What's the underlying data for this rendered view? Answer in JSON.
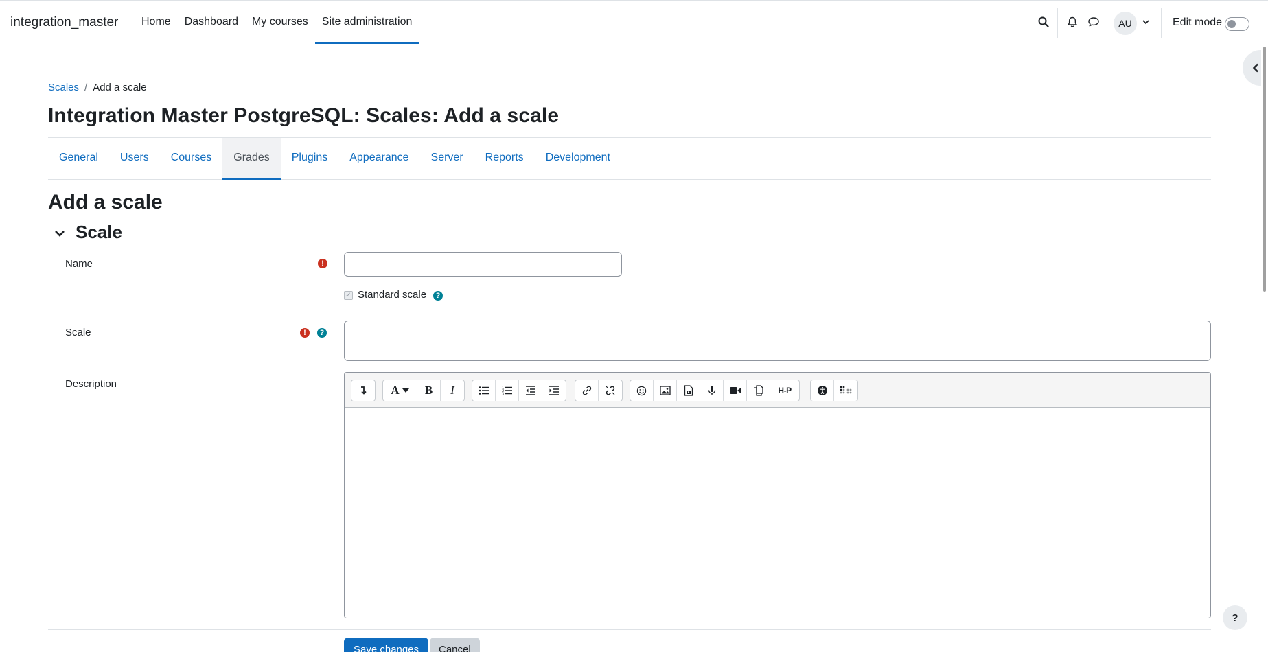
{
  "site": {
    "brand": "integration_master"
  },
  "primary_nav": [
    {
      "label": "Home",
      "active": false
    },
    {
      "label": "Dashboard",
      "active": false
    },
    {
      "label": "My courses",
      "active": false
    },
    {
      "label": "Site administration",
      "active": true
    }
  ],
  "user": {
    "initials": "AU"
  },
  "edit_mode": {
    "label": "Edit mode",
    "enabled": false
  },
  "breadcrumb": {
    "parent": "Scales",
    "separator": "/",
    "current": "Add a scale"
  },
  "page_title": "Integration Master PostgreSQL: Scales: Add a scale",
  "secondary_nav": [
    {
      "label": "General",
      "active": false
    },
    {
      "label": "Users",
      "active": false
    },
    {
      "label": "Courses",
      "active": false
    },
    {
      "label": "Grades",
      "active": true
    },
    {
      "label": "Plugins",
      "active": false
    },
    {
      "label": "Appearance",
      "active": false
    },
    {
      "label": "Server",
      "active": false
    },
    {
      "label": "Reports",
      "active": false
    },
    {
      "label": "Development",
      "active": false
    }
  ],
  "form": {
    "heading": "Add a scale",
    "section_title": "Scale",
    "name_label": "Name",
    "name_value": "",
    "standard_scale_label": "Standard scale",
    "standard_scale_checked": true,
    "scale_label": "Scale",
    "scale_value": "",
    "description_label": "Description",
    "description_value": "",
    "required_glyph": "!",
    "help_glyph": "?",
    "save_label": "Save changes",
    "cancel_label": "Cancel"
  },
  "editor_toolbar_icons": [
    "show-more-icon",
    "font-style-icon",
    "bold-icon",
    "italic-icon",
    "unordered-list-icon",
    "ordered-list-icon",
    "outdent-icon",
    "indent-icon",
    "link-icon",
    "unlink-icon",
    "emoji-icon",
    "image-icon",
    "media-icon",
    "record-audio-icon",
    "record-video-icon",
    "manage-files-icon",
    "h5p-icon",
    "accessibility-checker-icon",
    "screenreader-helper-icon"
  ],
  "toolbar_text": {
    "bold": "B",
    "italic": "I",
    "h5p": "H-P"
  },
  "help_fab": "?",
  "colors": {
    "primary": "#0f6cbf",
    "required": "#ca3120",
    "help": "#008196",
    "text": "#1d2125"
  }
}
